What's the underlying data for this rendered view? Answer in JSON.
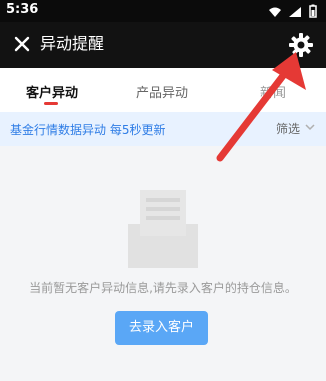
{
  "status": {
    "time": "5:36",
    "icons": [
      "wifi-icon",
      "signal-icon",
      "battery-icon"
    ]
  },
  "header": {
    "title": "异动提醒",
    "close_icon": "close-icon",
    "settings_icon": "gear-icon"
  },
  "tabs": [
    {
      "label": "客户异动",
      "active": true
    },
    {
      "label": "产品异动",
      "active": false
    },
    {
      "label": "新闻",
      "active": false
    }
  ],
  "banner": {
    "text": "基金行情数据异动   每5秒更新",
    "filter_label": "筛选"
  },
  "empty_state": {
    "message": "当前暂无客户异动信息,请先录入客户的持仓信息。",
    "button_label": "去录入客户"
  },
  "colors": {
    "accent_blue": "#2F7DE6",
    "tab_indicator": "#E53935",
    "annotation_arrow": "#E53935"
  }
}
